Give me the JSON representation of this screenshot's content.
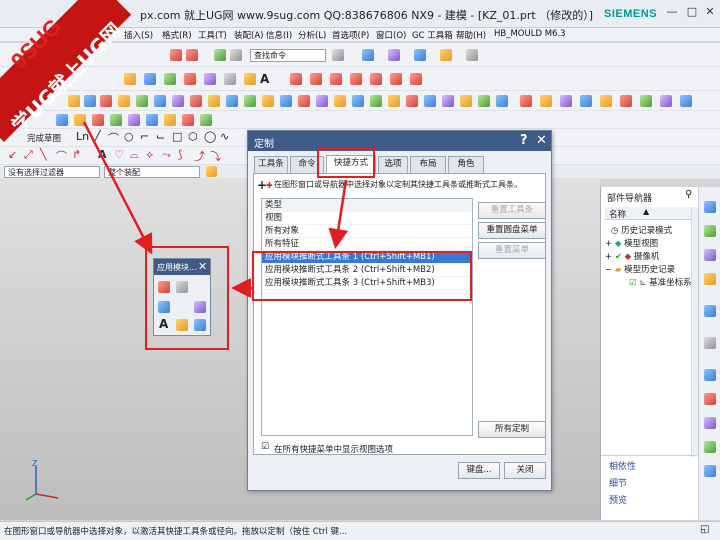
{
  "titlebar": {
    "title": "px.com 就上UG网 www.9sug.com QQ:838676806 NX9 - 建模 - [KZ_01.prt （修改的）]",
    "brand": "SIEMENS",
    "minimize": "—",
    "maximize": "□",
    "close": "✕"
  },
  "watermark": {
    "line1": "9SUG",
    "line2": "学UG就上UG网"
  },
  "menubar": {
    "items": [
      "插入(S)",
      "格式(R)",
      "工具(T)",
      "装配(A)",
      "信息(I)",
      "分析(L)",
      "首选项(P)",
      "窗口(O)",
      "GC 工具箱",
      "帮助(H)",
      "HB_MOULD M6.3"
    ]
  },
  "toolbar": {
    "command_search": "查找命令",
    "finish_sketch": "完成草图",
    "selection_filter": "没有选择过滤器",
    "assembly_scope": "整个装配"
  },
  "dialog": {
    "title": "定制",
    "help": "?",
    "close": "✕",
    "tabs": [
      "工具条",
      "命令",
      "快捷方式",
      "选项",
      "布局",
      "角色"
    ],
    "instruction": "在图形窗口或导航器中选择对象以定制其快捷工具条或推断式工具条。",
    "list_header": "类型",
    "list_items": [
      "视图",
      "所有对象",
      "所有特征",
      "应用模块推断式工具条 1 (Ctrl+Shift+MB1)",
      "应用模块推断式工具条 2 (Ctrl+Shift+MB2)",
      "应用模块推断式工具条 3 (Ctrl+Shift+MB3)"
    ],
    "btn_reset_toolbar": "重置工具条",
    "btn_reset_radial": "重置圆盘菜单",
    "btn_reset_menu": "重置菜单",
    "btn_all_custom": "所有定制",
    "checkbox_label": "在所有快捷菜单中显示视图选项",
    "checkbox_checked": true,
    "btn_keyboard": "键盘...",
    "btn_close": "关闭"
  },
  "minitoolbar": {
    "title": "应用模块...",
    "close": "✕"
  },
  "navigator": {
    "title": "部件导航器",
    "column": "名称",
    "nodes": [
      "历史记录模式",
      "模型视图",
      "摄像机",
      "模型历史记录",
      "基准坐标系"
    ],
    "links": [
      "相依性",
      "细节",
      "预览"
    ]
  },
  "statusbar": {
    "text": "在图形窗口或导航器中选择对象，以激活其快捷工具条或径向。拖放以定制（按住 Ctrl 键..."
  },
  "colors": {
    "dialog_title": "#3d5b86",
    "selection": "#3a78d6",
    "annotation_red": "#e02020",
    "brand_teal": "#009999"
  }
}
